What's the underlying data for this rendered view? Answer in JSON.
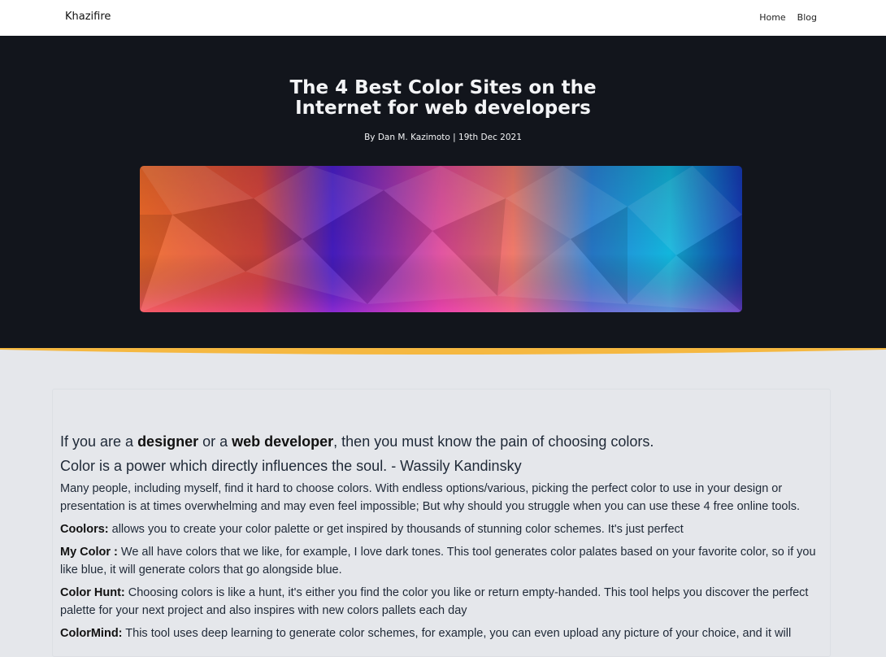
{
  "nav": {
    "brand": "Khazifire",
    "links": [
      "Home",
      "Blog"
    ]
  },
  "hero": {
    "title_line1": "The 4 Best Color Sites on the",
    "title_line2": "Internet for web developers",
    "byline": "By Dan M. Kazimoto | 19th Dec 2021",
    "accent_color": "#f5b841"
  },
  "article": {
    "intro": {
      "t1": "If you are a ",
      "b1": "designer",
      "t2": " or a ",
      "b2": "web developer",
      "t3": ", then you must know the pain of choosing colors."
    },
    "quote": "Color is a power which directly influences the soul. - Wassily Kandinsky",
    "paragraph": "Many people, including myself, find it hard to choose colors. With endless options/various, picking the perfect color to use in your design or presentation is at times overwhelming and may even feel impossible; But why should you struggle when you can use these 4 free online tools.",
    "tools": [
      {
        "name": "Coolors:",
        "text": " allows you to create your color palette or get inspired by thousands of stunning color schemes. It's just perfect"
      },
      {
        "name": "My Color :",
        "text": " We all have colors that we like, for example, I love dark tones. This tool generates color palates based on your favorite color, so if you like blue, it will generate colors that go alongside blue."
      },
      {
        "name": "Color Hunt:",
        "text": " Choosing colors is like a hunt, it's either you find the color you like or return empty-handed. This tool helps you discover the perfect palette for your next project and also inspires with new colors pallets each day"
      },
      {
        "name": "ColorMind:",
        "text": " This tool uses deep learning to generate color schemes, for example, you can even upload any picture of your choice, and it will"
      }
    ]
  }
}
